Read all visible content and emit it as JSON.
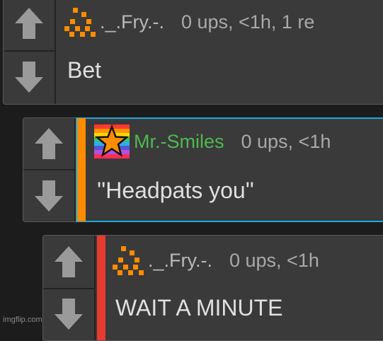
{
  "comments": [
    {
      "username": "._.Fry.-.",
      "meta": "0 ups, <1h, 1 re",
      "text": "Bet",
      "avatar": "pixel-flame-avatar",
      "colors": {
        "username": "#b9b9b9"
      }
    },
    {
      "username": "Mr.-Smiles",
      "meta": "0 ups, <1h",
      "text": "''Headpats you''",
      "avatar": "rainbow-star-avatar",
      "colors": {
        "username": "#4fb84f",
        "accent": "#ff8c00",
        "highlight": "#19a9d8"
      }
    },
    {
      "username": "._.Fry.-.",
      "meta": "0 ups, <1h",
      "text": "WAIT A MINUTE",
      "avatar": "pixel-flame-avatar",
      "colors": {
        "username": "#b9b9b9",
        "accent": "#e83a30"
      }
    }
  ],
  "icons": {
    "upvote": "arrow-up-icon",
    "downvote": "arrow-down-icon"
  },
  "watermark": "imgflip.com"
}
